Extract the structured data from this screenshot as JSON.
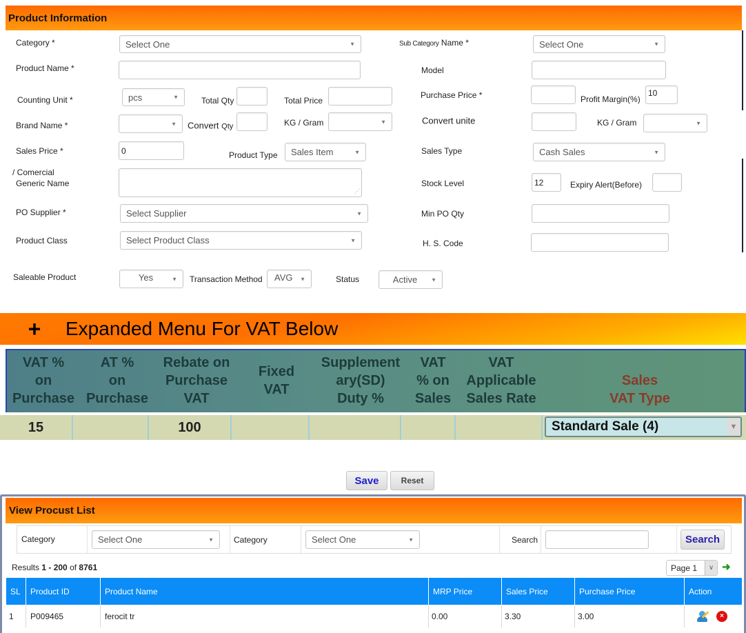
{
  "product_info": {
    "title": "Product Information",
    "category_label": "Category *",
    "category_value": "Select One",
    "subcategory_label_small": "Sub Category",
    "subcategory_label": "Name *",
    "subcategory_value": "Select One",
    "product_name_label": "Product Name *",
    "product_name_value": "",
    "model_label": "Model",
    "model_value": "",
    "counting_unit_label": "Counting Unit *",
    "counting_unit_value": "pcs",
    "total_qty_label": "Total Qty",
    "total_qty_value": "",
    "total_price_label": "Total Price",
    "total_price_value": "",
    "purchase_price_label": "Purchase Price *",
    "purchase_price_value": "",
    "profit_margin_label": "Profit Margin(%)",
    "profit_margin_value": "10",
    "brand_name_label": "Brand Name *",
    "brand_name_value": "",
    "convert_qty_label": "Convert",
    "convert_qty_label_small": "Qty",
    "convert_qty_value": "",
    "kg_gram_label": "KG / Gram",
    "kg_gram_value": "",
    "convert_unite_label": "Convert unite",
    "convert_unite_value": "",
    "kg_gram2_label": "KG / Gram",
    "kg_gram2_value": "",
    "sales_price_label": "Sales Price *",
    "sales_price_value": "0",
    "product_type_label": "Product Type",
    "product_type_value": "Sales Item",
    "sales_type_label": "Sales Type",
    "sales_type_value": "Cash Sales",
    "generic_name_label_1": "/ Comercial",
    "generic_name_label_2": "Generic Name",
    "generic_name_value": "",
    "stock_level_label": "Stock Level",
    "stock_level_value": "12",
    "expiry_alert_label": "Expiry Alert(Before)",
    "expiry_alert_value": "",
    "po_supplier_label": "PO Supplier *",
    "po_supplier_value": "Select Supplier",
    "min_po_qty_label": "Min PO Qty",
    "min_po_qty_value": "",
    "product_class_label": "Product Class",
    "product_class_value": "Select Product Class",
    "hs_code_label": "H. S. Code",
    "hs_code_value": "",
    "saleable_label": "Saleable Product",
    "saleable_value": "Yes",
    "transaction_method_label": "Transaction Method",
    "transaction_method_value": "AVG",
    "status_label": "Status",
    "status_value": "Active"
  },
  "vat": {
    "toggle_icon": "+",
    "title": "Expanded Menu For VAT Below",
    "headers": [
      "VAT %\non\nPurchase",
      "AT %\non\nPurchase",
      "Rebate on\nPurchase\nVAT",
      "Fixed\nVAT",
      "Supplement\nary(SD)\nDuty %",
      "VAT\n% on\nSales",
      "VAT\nApplicable\nSales Rate",
      "Sales\nVAT Type"
    ],
    "values": {
      "vat_on_purchase": "15",
      "at_on_purchase": "",
      "rebate": "100",
      "fixed_vat": "",
      "sd_duty": "",
      "vat_on_sales": "",
      "applicable_rate": "",
      "sales_vat_type": "Standard Sale (4)"
    }
  },
  "actions": {
    "save": "Save",
    "reset": "Reset"
  },
  "list": {
    "title": "View Procust List",
    "filter_category_label": "Category",
    "filter_category_value": "Select One",
    "filter_category2_label": "Category",
    "filter_category2_value": "Select One",
    "search_label": "Search",
    "search_value": "",
    "search_button": "Search",
    "results_prefix": "Results",
    "results_range": "1 - 200",
    "results_of": "of",
    "results_total": "8761",
    "page_value": "Page 1",
    "columns": [
      "SL",
      "Product ID",
      "Product Name",
      "MRP Price",
      "Sales Price",
      "Purchase Price",
      "Action"
    ],
    "rows": [
      {
        "sl": "1",
        "id": "P009465",
        "name": "ferocit tr",
        "mrp": "0.00",
        "sales": "3.30",
        "purchase": "3.00"
      }
    ]
  }
}
